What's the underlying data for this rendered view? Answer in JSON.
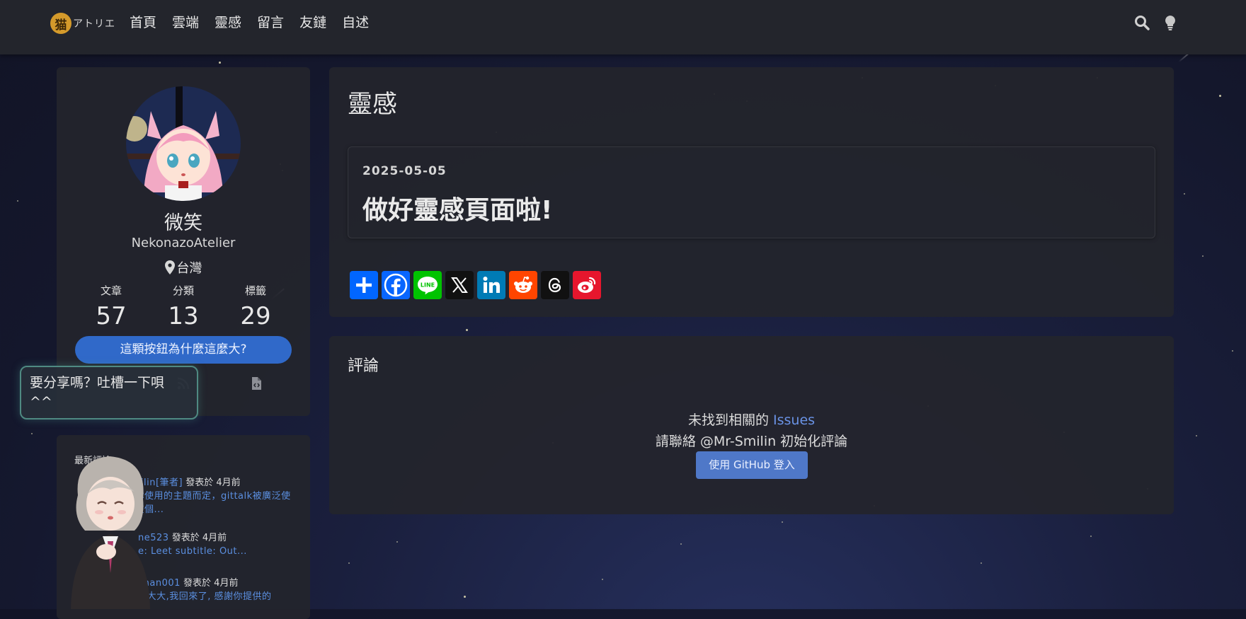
{
  "brand": {
    "logo_glyph": "猫",
    "name": "アトリエ",
    "accent": "#d49a2b"
  },
  "nav": {
    "items": [
      "首頁",
      "雲端",
      "靈感",
      "留言",
      "友鏈",
      "自述"
    ],
    "right_icons": [
      "search-icon",
      "lightbulb-icon"
    ]
  },
  "profile": {
    "name": "微笑",
    "handle": "NekonazoAtelier",
    "location": "台灣",
    "stats": [
      {
        "label": "文章",
        "value": "57"
      },
      {
        "label": "分類",
        "value": "13"
      },
      {
        "label": "標籤",
        "value": "29"
      }
    ],
    "big_button": "這顆按鈕為什麼這麼大?",
    "icons": [
      "rss-icon",
      "code-file-icon"
    ]
  },
  "bubble": {
    "text": "要分享嗎？吐槽一下唄 ^^"
  },
  "recent": {
    "title": "最新評論",
    "items": [
      {
        "user": "Smilin[筆者]",
        "meta": " 發表於 4月前",
        "text": "據你使用的主題而定，gittalk被廣泛使用在個..."
      },
      {
        "user": "ne523",
        "meta": " 發表於 4月前",
        "text": "e: Leet subtitle: Out..."
      },
      {
        "user": "chan001",
        "meta": " 發表於 4月前",
        "text": "lo大大,我回來了, 感謝你提供的"
      }
    ]
  },
  "page": {
    "title": "靈感",
    "post": {
      "date": "2025-05-05",
      "title": "做好靈感頁面啦!"
    },
    "share_buttons": [
      {
        "name": "share-add",
        "color": "#0166ff"
      },
      {
        "name": "facebook",
        "color": "#0866ff"
      },
      {
        "name": "line",
        "color": "#00c300"
      },
      {
        "name": "x",
        "color": "#111111"
      },
      {
        "name": "linkedin",
        "color": "#007bb5"
      },
      {
        "name": "reddit",
        "color": "#ff4500"
      },
      {
        "name": "threads",
        "color": "#111111"
      },
      {
        "name": "weibo",
        "color": "#e6162d"
      }
    ]
  },
  "comments": {
    "title": "評論",
    "empty_line1_prefix": "未找到相關的 ",
    "empty_line1_link": "Issues",
    "empty_line2": "請聯絡 @Mr-Smilin 初始化評論",
    "login_button": "使用 GitHub 登入"
  }
}
